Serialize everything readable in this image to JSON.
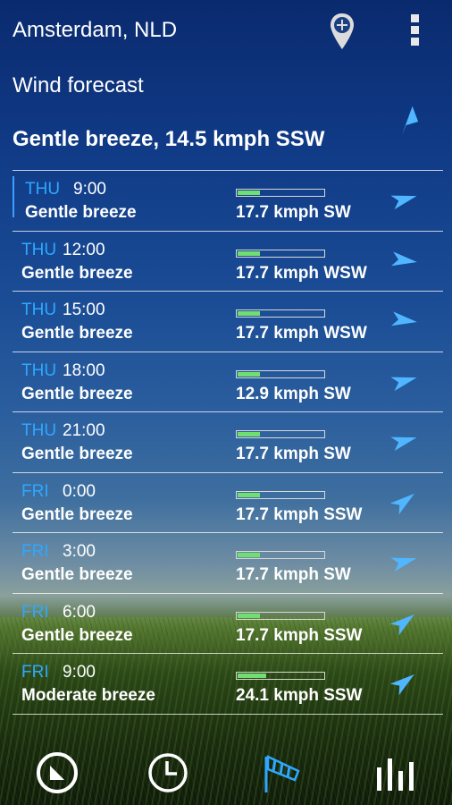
{
  "header": {
    "location": "Amsterdam, NLD",
    "add_location_icon": "add-location-pin-icon",
    "overflow_menu_icon": "vertical-dots-icon"
  },
  "page": {
    "subtitle": "Wind forecast",
    "current": "Gentle breeze, 14.5 kmph SSW",
    "current_direction": "SSW"
  },
  "forecast": [
    {
      "day": "THU",
      "time": "9:00",
      "condition": "Gentle breeze",
      "speed": "17.7 kmph SW",
      "direction": "SW",
      "level": 0.25,
      "selected": true
    },
    {
      "day": "THU",
      "time": "12:00",
      "condition": "Gentle breeze",
      "speed": "17.7 kmph WSW",
      "direction": "WSW",
      "level": 0.25
    },
    {
      "day": "THU",
      "time": "15:00",
      "condition": "Gentle breeze",
      "speed": "17.7 kmph WSW",
      "direction": "WSW",
      "level": 0.25
    },
    {
      "day": "THU",
      "time": "18:00",
      "condition": "Gentle breeze",
      "speed": "12.9 kmph SW",
      "direction": "SW",
      "level": 0.25
    },
    {
      "day": "THU",
      "time": "21:00",
      "condition": "Gentle breeze",
      "speed": "17.7 kmph SW",
      "direction": "SW",
      "level": 0.25
    },
    {
      "day": "FRI",
      "time": "0:00",
      "condition": "Gentle breeze",
      "speed": "17.7 kmph SSW",
      "direction": "SSW",
      "level": 0.25
    },
    {
      "day": "FRI",
      "time": "3:00",
      "condition": "Gentle breeze",
      "speed": "17.7 kmph SW",
      "direction": "SW",
      "level": 0.25
    },
    {
      "day": "FRI",
      "time": "6:00",
      "condition": "Gentle breeze",
      "speed": "17.7 kmph SSW",
      "direction": "SSW",
      "level": 0.25
    },
    {
      "day": "FRI",
      "time": "9:00",
      "condition": "Moderate breeze",
      "speed": "24.1 kmph SSW",
      "direction": "SSW",
      "level": 0.33
    }
  ],
  "bottom_nav": [
    {
      "name": "current-weather-tab",
      "icon": "clock-circle-icon"
    },
    {
      "name": "hourly-tab",
      "icon": "clock-icon"
    },
    {
      "name": "wind-tab",
      "icon": "windsock-icon",
      "active": true
    },
    {
      "name": "graphs-tab",
      "icon": "bar-graph-icon"
    }
  ],
  "colors": {
    "accent": "#2ea8ff",
    "bar_fill": "#6fe06f",
    "arrow": "#4fb6ff"
  }
}
